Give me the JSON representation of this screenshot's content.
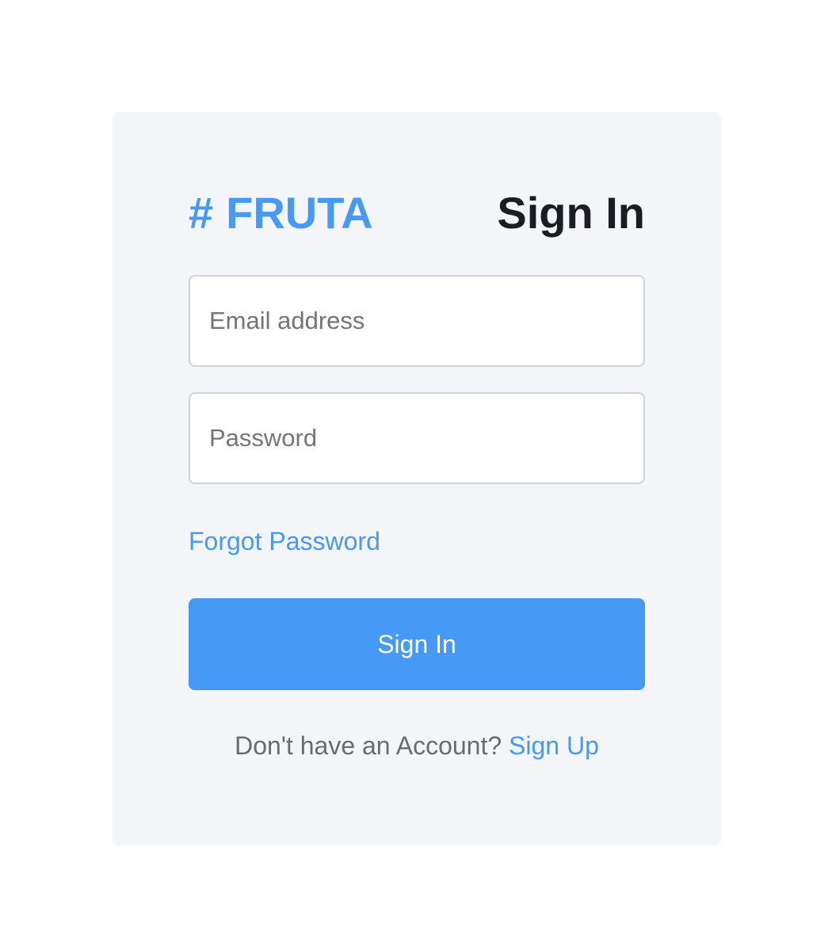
{
  "brand": {
    "icon": "hash-icon",
    "name": "FRUTA",
    "color": "#4699f5"
  },
  "page": {
    "title": "Sign In"
  },
  "form": {
    "email_placeholder": "Email address",
    "email_value": "",
    "password_placeholder": "Password",
    "password_value": "",
    "forgot_label": "Forgot Password",
    "submit_label": "Sign In"
  },
  "footer": {
    "prompt": "Don't have an Account?",
    "signup_label": "Sign Up"
  },
  "colors": {
    "accent": "#4699f5",
    "card_bg": "#f3f5f8",
    "title": "#1a1d24"
  }
}
